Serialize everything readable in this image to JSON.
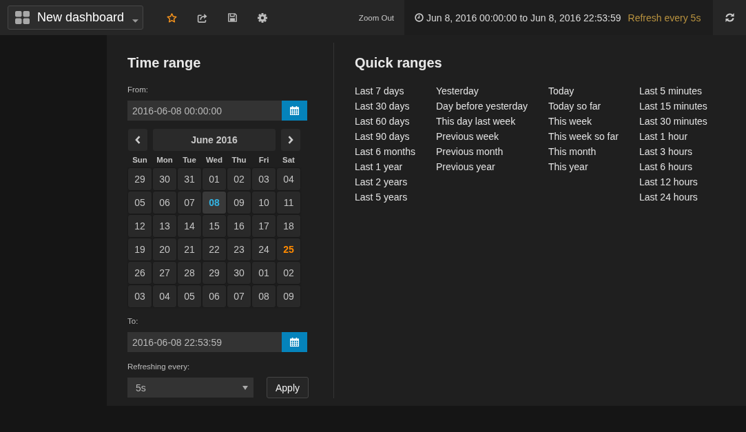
{
  "navbar": {
    "dashboard_title": "New dashboard",
    "zoom_out": "Zoom Out",
    "time_range": "Jun 8, 2016 00:00:00 to Jun 8, 2016 22:53:59",
    "refresh_interval": "Refresh every 5s"
  },
  "time_range": {
    "title": "Time range",
    "from": {
      "label": "From:",
      "value": "2016-06-08 00:00:00"
    },
    "calendar": {
      "month": "June 2016",
      "weekdays": [
        "Sun",
        "Mon",
        "Tue",
        "Wed",
        "Thu",
        "Fri",
        "Sat"
      ],
      "weeks": [
        [
          {
            "day": "29",
            "selected": false,
            "highlighted": false
          },
          {
            "day": "30",
            "selected": false,
            "highlighted": false
          },
          {
            "day": "31",
            "selected": false,
            "highlighted": false
          },
          {
            "day": "01",
            "selected": false,
            "highlighted": false
          },
          {
            "day": "02",
            "selected": false,
            "highlighted": false
          },
          {
            "day": "03",
            "selected": false,
            "highlighted": false
          },
          {
            "day": "04",
            "selected": false,
            "highlighted": false
          }
        ],
        [
          {
            "day": "05",
            "selected": false,
            "highlighted": false
          },
          {
            "day": "06",
            "selected": false,
            "highlighted": false
          },
          {
            "day": "07",
            "selected": false,
            "highlighted": false
          },
          {
            "day": "08",
            "selected": true,
            "highlighted": false
          },
          {
            "day": "09",
            "selected": false,
            "highlighted": false
          },
          {
            "day": "10",
            "selected": false,
            "highlighted": false
          },
          {
            "day": "11",
            "selected": false,
            "highlighted": false
          }
        ],
        [
          {
            "day": "12",
            "selected": false,
            "highlighted": false
          },
          {
            "day": "13",
            "selected": false,
            "highlighted": false
          },
          {
            "day": "14",
            "selected": false,
            "highlighted": false
          },
          {
            "day": "15",
            "selected": false,
            "highlighted": false
          },
          {
            "day": "16",
            "selected": false,
            "highlighted": false
          },
          {
            "day": "17",
            "selected": false,
            "highlighted": false
          },
          {
            "day": "18",
            "selected": false,
            "highlighted": false
          }
        ],
        [
          {
            "day": "19",
            "selected": false,
            "highlighted": false
          },
          {
            "day": "20",
            "selected": false,
            "highlighted": false
          },
          {
            "day": "21",
            "selected": false,
            "highlighted": false
          },
          {
            "day": "22",
            "selected": false,
            "highlighted": false
          },
          {
            "day": "23",
            "selected": false,
            "highlighted": false
          },
          {
            "day": "24",
            "selected": false,
            "highlighted": false
          },
          {
            "day": "25",
            "selected": false,
            "highlighted": true
          }
        ],
        [
          {
            "day": "26",
            "selected": false,
            "highlighted": false
          },
          {
            "day": "27",
            "selected": false,
            "highlighted": false
          },
          {
            "day": "28",
            "selected": false,
            "highlighted": false
          },
          {
            "day": "29",
            "selected": false,
            "highlighted": false
          },
          {
            "day": "30",
            "selected": false,
            "highlighted": false
          },
          {
            "day": "01",
            "selected": false,
            "highlighted": false
          },
          {
            "day": "02",
            "selected": false,
            "highlighted": false
          }
        ],
        [
          {
            "day": "03",
            "selected": false,
            "highlighted": false
          },
          {
            "day": "04",
            "selected": false,
            "highlighted": false
          },
          {
            "day": "05",
            "selected": false,
            "highlighted": false
          },
          {
            "day": "06",
            "selected": false,
            "highlighted": false
          },
          {
            "day": "07",
            "selected": false,
            "highlighted": false
          },
          {
            "day": "08",
            "selected": false,
            "highlighted": false
          },
          {
            "day": "09",
            "selected": false,
            "highlighted": false
          }
        ]
      ]
    },
    "to": {
      "label": "To:",
      "value": "2016-06-08 22:53:59"
    },
    "refresh": {
      "label": "Refreshing every:",
      "value": "5s"
    },
    "apply": "Apply"
  },
  "quick_ranges": {
    "title": "Quick ranges",
    "columns": [
      [
        "Last 7 days",
        "Last 30 days",
        "Last 60 days",
        "Last 90 days",
        "Last 6 months",
        "Last 1 year",
        "Last 2 years",
        "Last 5 years"
      ],
      [
        "Yesterday",
        "Day before yesterday",
        "This day last week",
        "Previous week",
        "Previous month",
        "Previous year"
      ],
      [
        "Today",
        "Today so far",
        "This week",
        "This week so far",
        "This month",
        "This year"
      ],
      [
        "Last 5 minutes",
        "Last 15 minutes",
        "Last 30 minutes",
        "Last 1 hour",
        "Last 3 hours",
        "Last 6 hours",
        "Last 12 hours",
        "Last 24 hours"
      ]
    ]
  }
}
